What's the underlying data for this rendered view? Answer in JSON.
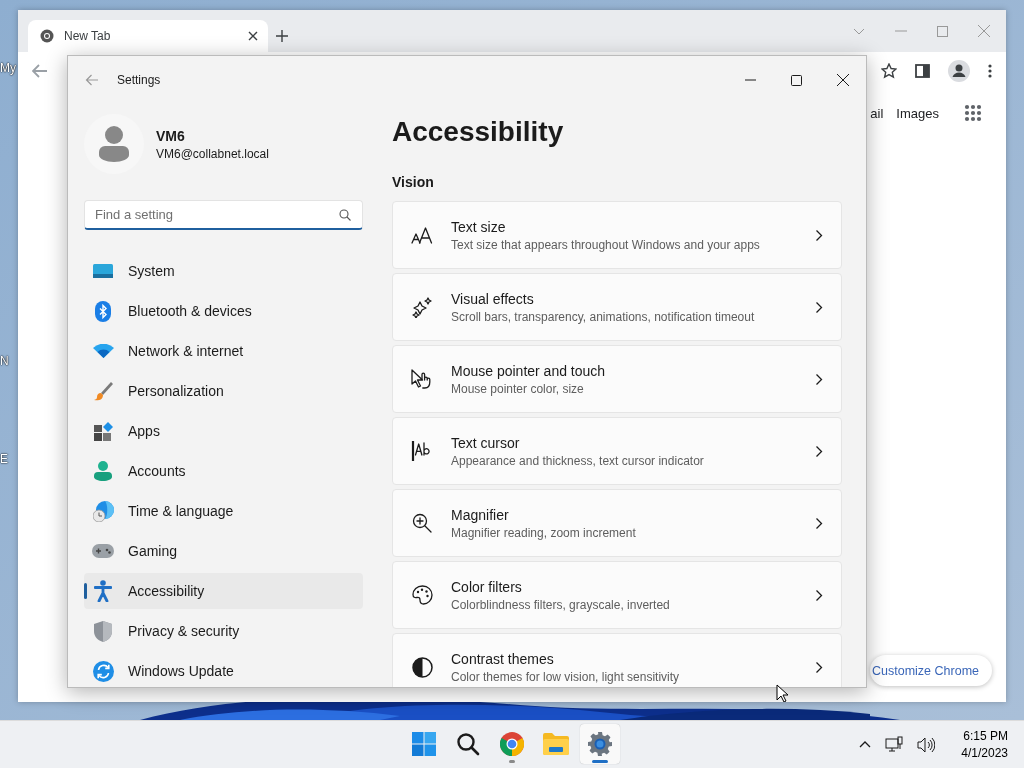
{
  "desktop": {
    "icon_labels": [
      "My",
      "N",
      "E"
    ]
  },
  "browser": {
    "tab": {
      "title": "New Tab",
      "selected": true
    },
    "links": [
      "ail",
      "Images"
    ],
    "customize_button": "Customize Chrome"
  },
  "settings": {
    "title": "Settings",
    "user": {
      "name": "VM6",
      "email": "VM6@collabnet.local"
    },
    "search": {
      "placeholder": "Find a setting"
    },
    "nav": [
      {
        "label": "System",
        "kind": "system",
        "selected": false
      },
      {
        "label": "Bluetooth & devices",
        "kind": "bluetooth",
        "selected": false
      },
      {
        "label": "Network & internet",
        "kind": "network",
        "selected": false
      },
      {
        "label": "Personalization",
        "kind": "personalization",
        "selected": false
      },
      {
        "label": "Apps",
        "kind": "apps",
        "selected": false
      },
      {
        "label": "Accounts",
        "kind": "accounts",
        "selected": false
      },
      {
        "label": "Time & language",
        "kind": "time",
        "selected": false
      },
      {
        "label": "Gaming",
        "kind": "gaming",
        "selected": false
      },
      {
        "label": "Accessibility",
        "kind": "accessibility",
        "selected": true
      },
      {
        "label": "Privacy & security",
        "kind": "privacy",
        "selected": false
      },
      {
        "label": "Windows Update",
        "kind": "update",
        "selected": false
      }
    ],
    "page_title": "Accessibility",
    "section": "Vision",
    "cards": [
      {
        "title": "Text size",
        "description": "Text size that appears throughout Windows and your apps",
        "kind": "text-size"
      },
      {
        "title": "Visual effects",
        "description": "Scroll bars, transparency, animations, notification timeout",
        "kind": "visual-effects"
      },
      {
        "title": "Mouse pointer and touch",
        "description": "Mouse pointer color, size",
        "kind": "mouse-pointer"
      },
      {
        "title": "Text cursor",
        "description": "Appearance and thickness, text cursor indicator",
        "kind": "text-cursor"
      },
      {
        "title": "Magnifier",
        "description": "Magnifier reading, zoom increment",
        "kind": "magnifier"
      },
      {
        "title": "Color filters",
        "description": "Colorblindness filters, grayscale, inverted",
        "kind": "color-filters"
      },
      {
        "title": "Contrast themes",
        "description": "Color themes for low vision, light sensitivity",
        "kind": "contrast"
      }
    ]
  },
  "taskbar": {
    "apps": [
      {
        "kind": "start",
        "running": false,
        "selected": false
      },
      {
        "kind": "search",
        "running": false,
        "selected": false
      },
      {
        "kind": "chrome",
        "running": true,
        "selected": false
      },
      {
        "kind": "explorer",
        "running": false,
        "selected": false
      },
      {
        "kind": "settings",
        "running": true,
        "selected": true
      }
    ],
    "clock": {
      "time": "6:15 PM",
      "date": "4/1/2023"
    }
  }
}
